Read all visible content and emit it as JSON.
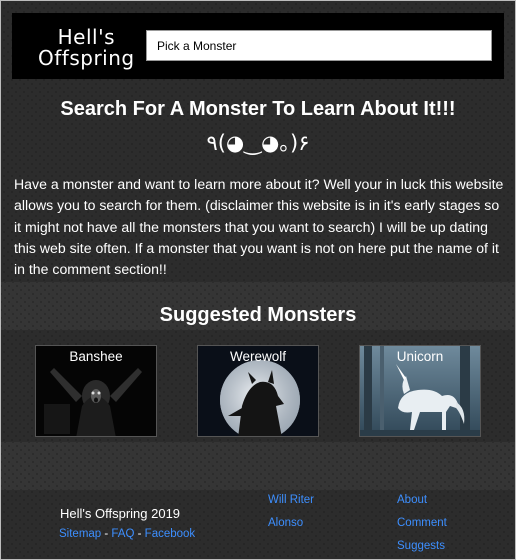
{
  "header": {
    "logo_line1": "Hell's",
    "logo_line2": "Offspring",
    "search_value": "Pick a Monster"
  },
  "main": {
    "title": "Search For A Monster To Learn About It!!!",
    "kaomoji": "٩(◕‿◕｡)۶",
    "intro": "Have a monster and want to learn more about it? Well your in luck this website allows you to search for them. (disclaimer this website is in it's early stages so it might not have all the monsters that you want to search) I will be up dating this web site often. If a monster that you want is not on here put the name of it in the comment section!!"
  },
  "suggested": {
    "heading": "Suggested Monsters",
    "cards": [
      {
        "label": "Banshee"
      },
      {
        "label": "Werewolf"
      },
      {
        "label": "Unicorn"
      }
    ]
  },
  "footer": {
    "site_name": "Hell's Offspring 2019",
    "links": {
      "sitemap": "Sitemap",
      "faq": "FAQ",
      "facebook": "Facebook",
      "separator": " - "
    },
    "col1": [
      "Will Riter",
      "Alonso"
    ],
    "col2": [
      "About",
      "Comment",
      "Suggests"
    ]
  },
  "colors": {
    "link": "#3d8fff",
    "header_bg": "#000000",
    "page_bg": "#202020"
  }
}
